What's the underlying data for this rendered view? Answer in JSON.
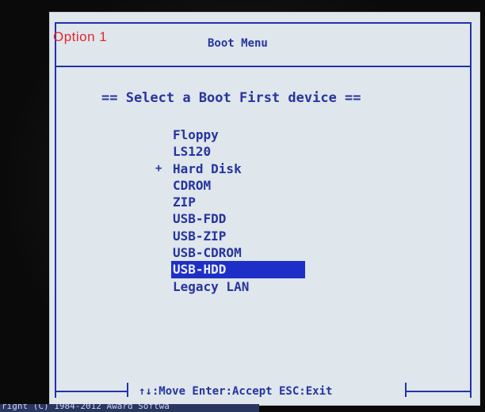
{
  "overlay_label": "Option 1",
  "window": {
    "title": "Boot Menu",
    "subtitle": "== Select a Boot First device =="
  },
  "menu": {
    "items": [
      {
        "label": "Floppy"
      },
      {
        "label": "LS120"
      },
      {
        "label": "Hard Disk",
        "marker": "+"
      },
      {
        "label": "CDROM"
      },
      {
        "label": "ZIP"
      },
      {
        "label": "USB-FDD"
      },
      {
        "label": "USB-ZIP"
      },
      {
        "label": "USB-CDROM"
      },
      {
        "label": "USB-HDD",
        "selected": true
      },
      {
        "label": "Legacy LAN"
      }
    ],
    "selected_index": 8
  },
  "footer": {
    "help": "↑↓:Move Enter:Accept ESC:Exit"
  },
  "bottom_strip": {
    "text": "right (C) 1984-2012 Award Softwa"
  },
  "colors": {
    "screen_bg": "#dfe6ec",
    "text": "#26349e",
    "highlight_bg": "#1e2fc7",
    "highlight_text": "#e9eef8",
    "overlay_label": "#e0282c"
  }
}
